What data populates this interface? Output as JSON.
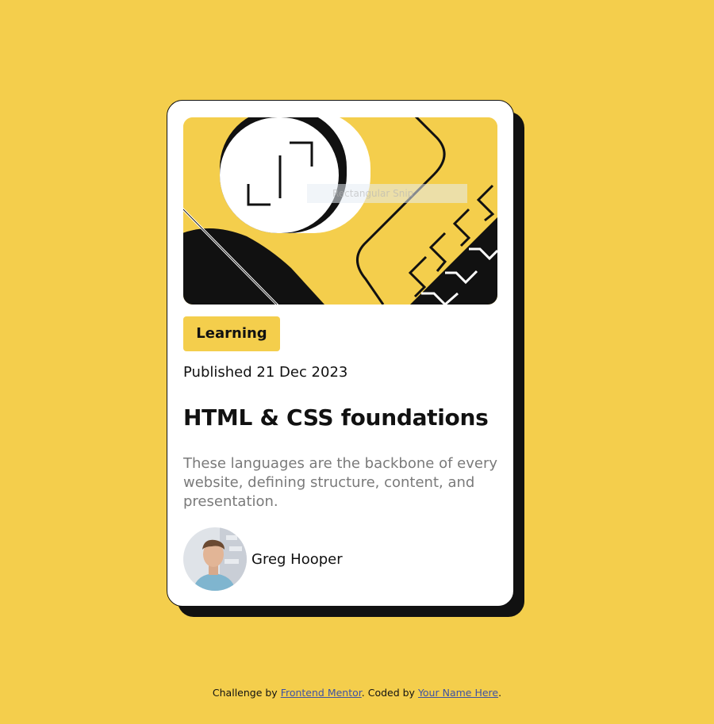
{
  "page": {
    "background": "#f4ce4c"
  },
  "card": {
    "image_alt": "Rectangular Snip",
    "category": "Learning",
    "published": "Published 21 Dec 2023",
    "title": "HTML & CSS foundations",
    "description": "These languages are the backbone of every website, defining structure, content, and presentation.",
    "author": {
      "name": "Greg Hooper"
    }
  },
  "footer": {
    "prefix": "Challenge by ",
    "link1": "Frontend Mentor",
    "middle": ". Coded by ",
    "link2": "Your Name Here",
    "suffix": "."
  },
  "colors": {
    "accent": "#f4ce4c",
    "ink": "#111111",
    "muted": "#7a7a7a",
    "link": "#3e52a3"
  }
}
